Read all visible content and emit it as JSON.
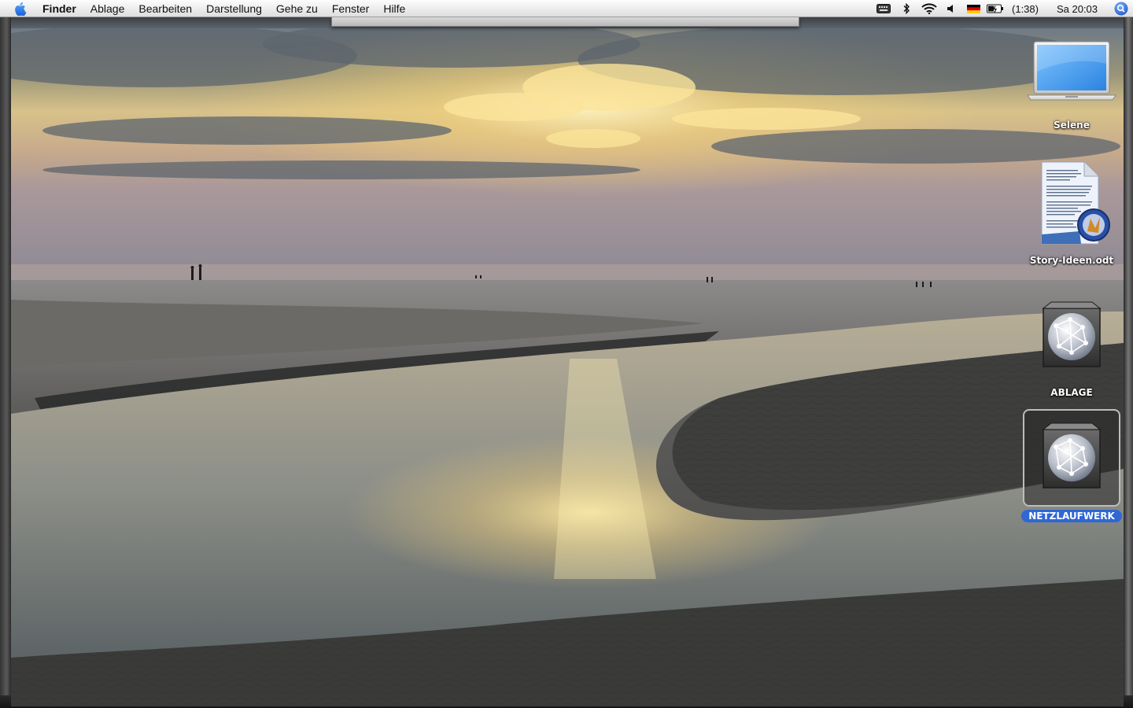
{
  "menubar": {
    "app_name": "Finder",
    "menus": [
      "Ablage",
      "Bearbeiten",
      "Darstellung",
      "Gehe zu",
      "Fenster",
      "Hilfe"
    ],
    "battery_remaining": "(1:38)",
    "clock": "Sa 20:03",
    "icons": [
      "apple-icon",
      "keyboard-icon",
      "bluetooth-icon",
      "wifi-icon",
      "volume-icon",
      "german-flag-icon",
      "battery-icon",
      "spotlight-icon"
    ]
  },
  "desktop": {
    "icons": [
      {
        "label": "Selene",
        "icon": "laptop-icon"
      },
      {
        "label": "Story-Ideen.odt",
        "icon": "document-icon"
      },
      {
        "label": "ABLAGE",
        "icon": "network-volume-icon"
      },
      {
        "label": "NETZLAUFWERK",
        "icon": "network-volume-icon",
        "selected": true
      }
    ]
  },
  "colors": {
    "selection": "#2f67d5",
    "spotlight": "#2a66d9"
  }
}
